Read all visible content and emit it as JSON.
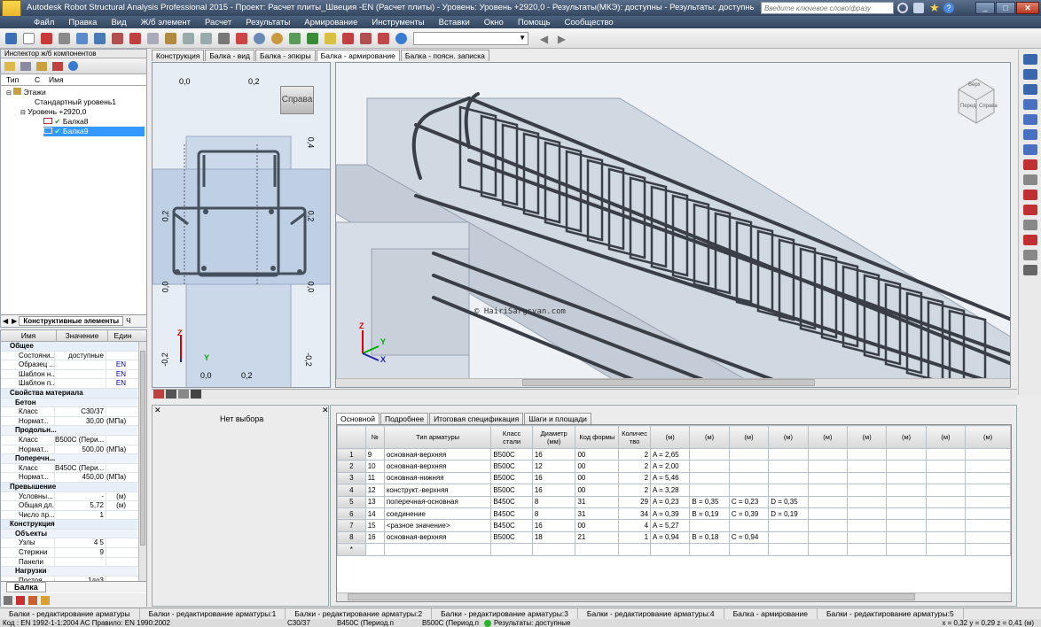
{
  "window": {
    "title": "Autodesk Robot Structural Analysis Professional 2015 - Проект: Расчет плиты_Швеция -EN (Расчет плиты) - Уровень: Уровень +2920,0 - Результаты(МКЭ): доступны - Результаты: доступные",
    "search_placeholder": "Введите ключевое слово/фразу",
    "app_badge": "PRO"
  },
  "menu": [
    "Файл",
    "Правка",
    "Вид",
    "Ж/б элемент",
    "Расчет",
    "Результаты",
    "Армирование",
    "Инструменты",
    "Вставки",
    "Окно",
    "Помощь",
    "Сообщество"
  ],
  "inspector": {
    "title": "Инспектор ж/б компонентов",
    "columns": [
      "Тип",
      "С",
      "Имя"
    ],
    "tree": [
      {
        "label": "Этажи",
        "level": 0
      },
      {
        "label": "Стандартный уровень1",
        "level": 1
      },
      {
        "label": "Уровень +2920,0",
        "level": 1
      },
      {
        "label": "Балка8",
        "level": 2
      },
      {
        "label": "Балка9",
        "level": 2,
        "selected": true
      }
    ],
    "bottom_tab": "Конструктивные элементы",
    "bottom_tab_cut": "Ч"
  },
  "properties": {
    "columns": [
      "Имя",
      "Значение",
      "Един"
    ],
    "rows": [
      {
        "type": "group",
        "name": "Общее"
      },
      {
        "name": "Состояни...",
        "value": "доступные",
        "unit": ""
      },
      {
        "name": "Образец ...",
        "value": "",
        "unit": "EN"
      },
      {
        "name": "Шаблон н...",
        "value": "",
        "unit": "EN"
      },
      {
        "name": "Шаблон п...",
        "value": "",
        "unit": "EN"
      },
      {
        "type": "group",
        "name": "Свойства материала"
      },
      {
        "type": "sub",
        "name": "Бетон"
      },
      {
        "name": "Класс",
        "value": "C30/37",
        "unit": ""
      },
      {
        "name": "Нормат...",
        "value": "30,00",
        "unit": "(MПa)"
      },
      {
        "type": "sub",
        "name": "Продольн..."
      },
      {
        "name": "Класс",
        "value": "B500C (Пери...",
        "unit": ""
      },
      {
        "name": "Нормат...",
        "value": "500,00",
        "unit": "(MПa)"
      },
      {
        "type": "sub",
        "name": "Поперечн..."
      },
      {
        "name": "Класс",
        "value": "B450C (Пери...",
        "unit": ""
      },
      {
        "name": "Нормат...",
        "value": "450,00",
        "unit": "(MПa)"
      },
      {
        "type": "group",
        "name": "Превышение"
      },
      {
        "name": "Условны...",
        "value": "-",
        "unit": "(м)"
      },
      {
        "name": "Общая дл...",
        "value": "5,72",
        "unit": "(м)"
      },
      {
        "name": "Число пр...",
        "value": "1",
        "unit": ""
      },
      {
        "type": "group",
        "name": "Конструкция"
      },
      {
        "type": "sub",
        "name": "Объекты"
      },
      {
        "name": "Узлы",
        "value": "4 5",
        "unit": ""
      },
      {
        "name": "Стержни",
        "value": "9",
        "unit": ""
      },
      {
        "name": "Панели",
        "value": "",
        "unit": ""
      },
      {
        "type": "sub",
        "name": "Нагрузки"
      },
      {
        "name": "Постоя...",
        "value": "1до3",
        "unit": ""
      }
    ],
    "bottom_tab": "Балка"
  },
  "view_tabs": [
    "Конструкция",
    "Балка - вид",
    "Балка - эпюры",
    "Балка - армирование",
    "Балка - поясн. записка"
  ],
  "active_view_tab": "Балка - армирование",
  "section_view": {
    "top_labels": [
      "0,0",
      "0,2"
    ],
    "right_labels": [
      "0,4",
      "0,2",
      "0,0",
      "-0,2"
    ],
    "left_labels": [
      "0,2",
      "0,0",
      "-0,2"
    ],
    "bottom_labels": [
      "0,0",
      "0,2"
    ],
    "view_button": "Справа",
    "axis_z": "Z",
    "axis_y": "Y"
  },
  "view3d": {
    "watermark": "© HairiSargsyan.com",
    "viewcube": [
      "Верх",
      "Перед",
      "Справа"
    ],
    "axis_z": "Z",
    "axis_y": "Y",
    "axis_x": "X"
  },
  "no_selection": "Нет выбора",
  "grid_tabs": [
    "Основной",
    "Подробнее",
    "Итоговая спецификация",
    "Шаги и площади"
  ],
  "active_grid_tab": "Основной",
  "table": {
    "headers": [
      "№",
      "Тип арматуры",
      "Класс стали",
      "Диаметр (мм)",
      "Код формы",
      "Количество",
      "(м)",
      "(м)",
      "(м)",
      "(м)",
      "(м)",
      "(м)",
      "(м)",
      "(м)",
      "(м)"
    ],
    "rows": [
      {
        "rh": "1",
        "no": "9",
        "type": "основная-верхняя",
        "cls": "B500C",
        "d": "16",
        "code": "00",
        "qty": "2",
        "a": "A = 2,65",
        "b": "",
        "c": "",
        "dd": ""
      },
      {
        "rh": "2",
        "no": "10",
        "type": "основная-верхняя",
        "cls": "B500C",
        "d": "12",
        "code": "00",
        "qty": "2",
        "a": "A = 2,00",
        "b": "",
        "c": "",
        "dd": ""
      },
      {
        "rh": "3",
        "no": "11",
        "type": "основная-нижняя",
        "cls": "B500C",
        "d": "16",
        "code": "00",
        "qty": "2",
        "a": "A = 5,46",
        "b": "",
        "c": "",
        "dd": ""
      },
      {
        "rh": "4",
        "no": "12",
        "type": "конструкт.-верхняя",
        "cls": "B500C",
        "d": "16",
        "code": "00",
        "qty": "2",
        "a": "A = 3,28",
        "b": "",
        "c": "",
        "dd": ""
      },
      {
        "rh": "5",
        "no": "13",
        "type": "поперечная-основная",
        "cls": "B450C",
        "d": "8",
        "code": "31",
        "qty": "29",
        "a": "A = 0,23",
        "b": "B = 0,35",
        "c": "C = 0,23",
        "dd": "D = 0,35"
      },
      {
        "rh": "6",
        "no": "14",
        "type": "соединение",
        "cls": "B450C",
        "d": "8",
        "code": "31",
        "qty": "34",
        "a": "A = 0,39",
        "b": "B = 0,19",
        "c": "C = 0,39",
        "dd": "D = 0,19"
      },
      {
        "rh": "7",
        "no": "15",
        "type": "<разное значение>",
        "cls": "B450C",
        "d": "16",
        "code": "00",
        "qty": "4",
        "a": "A = 5,27",
        "b": "",
        "c": "",
        "dd": ""
      },
      {
        "rh": "8",
        "no": "16",
        "type": "основная-верхняя",
        "cls": "B500C",
        "d": "18",
        "code": "21",
        "qty": "1",
        "a": "A = 0,94",
        "b": "B = 0,18",
        "c": "C = 0,94",
        "dd": ""
      },
      {
        "rh": "*",
        "no": "",
        "type": "",
        "cls": "",
        "d": "",
        "code": "",
        "qty": "",
        "a": "",
        "b": "",
        "c": "",
        "dd": ""
      }
    ]
  },
  "status_tabs": [
    "Балки - редактирование арматуры",
    "Балки - редактирование арматуры:1",
    "Балки - редактирование арматуры:2",
    "Балки - редактирование арматуры:3",
    "Балки - редактирование арматуры:4",
    "Балка - армирование",
    "Балки - редактирование арматуры:5"
  ],
  "statusbar": {
    "code": "Код : EN 1992-1-1:2004 AC  Правило: EN 1990:2002",
    "concrete": "C30/37",
    "steel1": "B450C (Период.п",
    "steel2": "B500C (Период.п",
    "results": "Результаты: доступные",
    "coords": "x = 0,32  y = 0,29  z = 0,41  (м)"
  }
}
